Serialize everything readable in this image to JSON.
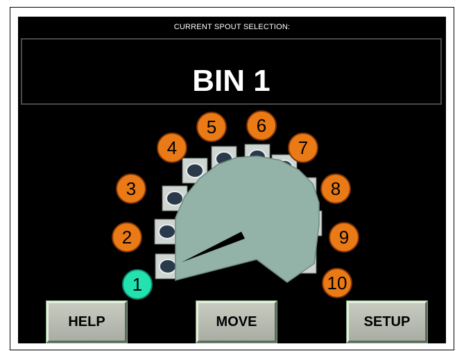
{
  "header": {
    "caption": "CURRENT SPOUT SELECTION:",
    "current_bin": "BIN 1"
  },
  "spouts": {
    "selected": "1",
    "labels": [
      "1",
      "2",
      "3",
      "4",
      "5",
      "6",
      "7",
      "8",
      "9",
      "10"
    ],
    "colors": {
      "selected": "#22e3b0",
      "unselected": "#ea7a16",
      "unselected_outline": "#7d3306",
      "turret_body": "#93b2a8",
      "ring_segment": "#cfd6d1"
    }
  },
  "buttons": {
    "help": "HELP",
    "move": "MOVE",
    "setup": "SETUP"
  }
}
